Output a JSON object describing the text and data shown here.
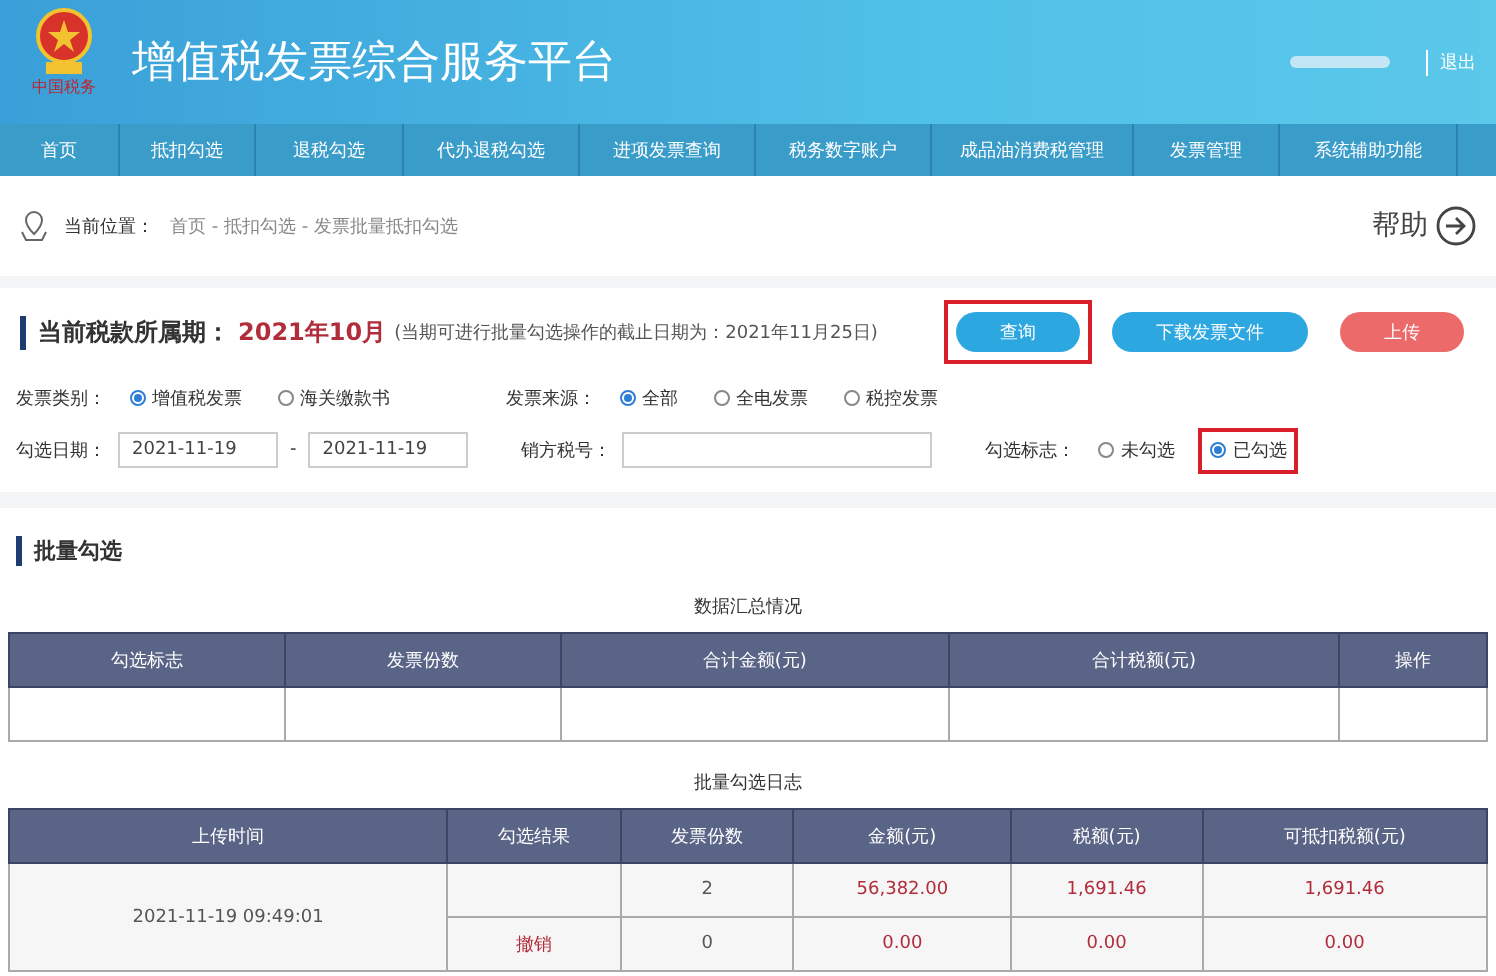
{
  "header": {
    "title": "增值税发票综合服务平台",
    "logo_text": "中国税务",
    "logout": "退出"
  },
  "nav": [
    {
      "label": "首页",
      "selected": false
    },
    {
      "label": "抵扣勾选",
      "selected": false
    },
    {
      "label": "退税勾选",
      "selected": false
    },
    {
      "label": "代办退税勾选",
      "selected": false
    },
    {
      "label": "进项发票查询",
      "selected": false
    },
    {
      "label": "税务数字账户",
      "selected": false
    },
    {
      "label": "成品油消费税管理",
      "selected": false
    },
    {
      "label": "发票管理",
      "selected": false
    },
    {
      "label": "系统辅助功能",
      "selected": false
    }
  ],
  "breadcrumb": {
    "label": "当前位置：",
    "path": "首页 - 抵扣勾选 - 发票批量抵扣勾选",
    "help": "帮助"
  },
  "period": {
    "label": "当前税款所属期：",
    "value": "2021年10月",
    "note": "(当期可进行批量勾选操作的截止日期为：2021年11月25日)"
  },
  "buttons": [
    {
      "label": "查询",
      "kind": "primary",
      "highlighted": true
    },
    {
      "label": "下载发票文件",
      "kind": "primary",
      "highlighted": false
    },
    {
      "label": "上传",
      "kind": "danger",
      "highlighted": false
    }
  ],
  "invoice_type": {
    "label": "发票类别：",
    "options": [
      {
        "label": "增值税发票",
        "selected": true
      },
      {
        "label": "海关缴款书",
        "selected": false
      }
    ]
  },
  "invoice_source": {
    "label": "发票来源：",
    "options": [
      {
        "label": "全部",
        "selected": true
      },
      {
        "label": "全电发票",
        "selected": false
      },
      {
        "label": "税控发票",
        "selected": false
      }
    ]
  },
  "date": {
    "label": "勾选日期：",
    "from": "2021-11-19",
    "separator": "-",
    "to": "2021-11-19"
  },
  "seller_tax_id": {
    "label": "销方税号："
  },
  "check_flag": {
    "label": "勾选标志：",
    "options": [
      {
        "label": "未勾选",
        "selected": false,
        "highlighted": false
      },
      {
        "label": "已勾选",
        "selected": true,
        "highlighted": true
      }
    ]
  },
  "section_title": "批量勾选",
  "summary": {
    "caption": "数据汇总情况",
    "columns": [
      "勾选标志",
      "发票份数",
      "合计金额(元)",
      "合计税额(元)",
      "操作"
    ]
  },
  "log": {
    "caption": "批量勾选日志",
    "columns": [
      "上传时间",
      "勾选结果",
      "发票份数",
      "金额(元)",
      "税额(元)",
      "可抵扣税额(元)"
    ],
    "groups": [
      {
        "upload_time": "2021-11-19 09:49:01",
        "rows": [
          {
            "count": "2",
            "amount": "56,382.00",
            "tax": "1,691.46",
            "deductible": "1,691.46"
          },
          {
            "result": "撤销",
            "count": "0",
            "amount": "0.00",
            "tax": "0.00",
            "deductible": "0.00"
          }
        ]
      }
    ]
  }
}
